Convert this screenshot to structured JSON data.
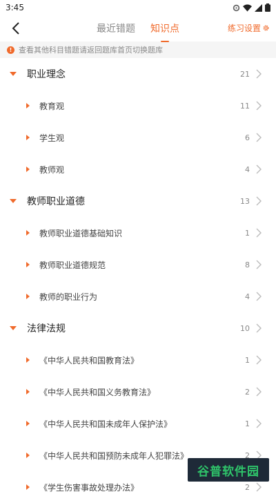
{
  "status_bar": {
    "time": "3:45"
  },
  "header": {
    "tabs": [
      {
        "label": "最近错题",
        "active": false
      },
      {
        "label": "知识点",
        "active": true
      }
    ],
    "settings_label": "练习设置"
  },
  "notice": {
    "text": "查看其他科目错题请返回题库首页切换题库"
  },
  "categories": [
    {
      "label": "职业理念",
      "count": "21",
      "children": [
        {
          "label": "教育观",
          "count": "11"
        },
        {
          "label": "学生观",
          "count": "6"
        },
        {
          "label": "教师观",
          "count": "4"
        }
      ]
    },
    {
      "label": "教师职业道德",
      "count": "13",
      "children": [
        {
          "label": "教师职业道德基础知识",
          "count": "1"
        },
        {
          "label": "教师职业道德规范",
          "count": "8"
        },
        {
          "label": "教师的职业行为",
          "count": "4"
        }
      ]
    },
    {
      "label": "法律法规",
      "count": "10",
      "children": [
        {
          "label": "《中华人民共和国教育法》",
          "count": "1"
        },
        {
          "label": "《中华人民共和国义务教育法》",
          "count": "2"
        },
        {
          "label": "《中华人民共和国未成年人保护法》",
          "count": "1"
        },
        {
          "label": "《中华人民共和国预防未成年人犯罪法》",
          "count": "2"
        },
        {
          "label": "《学生伤害事故处理办法》",
          "count": "2"
        }
      ]
    }
  ],
  "watermark": {
    "text": "谷普软件园"
  },
  "colors": {
    "accent": "#f06a2b",
    "muted": "#888888"
  }
}
